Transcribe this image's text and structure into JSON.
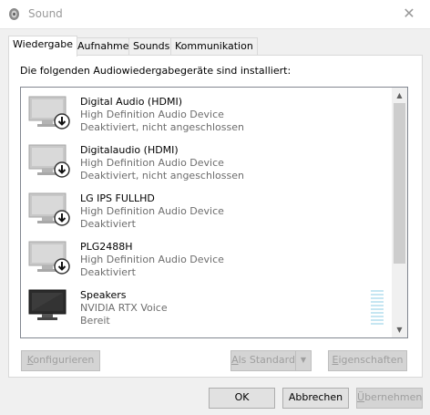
{
  "window": {
    "title": "Sound",
    "close_glyph": "✕"
  },
  "tabs": [
    {
      "label": "Wiedergabe"
    },
    {
      "label": "Aufnahme"
    },
    {
      "label": "Sounds"
    },
    {
      "label": "Kommunikation"
    }
  ],
  "instruction": "Die folgenden Audiowiedergabegeräte sind installiert:",
  "devices": [
    {
      "name": "Digital Audio (HDMI)",
      "driver": "High Definition Audio Device",
      "status": "Deaktiviert, nicht angeschlossen",
      "icon": "monitor-disabled-icon"
    },
    {
      "name": "Digitalaudio (HDMI)",
      "driver": "High Definition Audio Device",
      "status": "Deaktiviert, nicht angeschlossen",
      "icon": "monitor-disabled-icon"
    },
    {
      "name": "LG IPS FULLHD",
      "driver": "High Definition Audio Device",
      "status": "Deaktiviert",
      "icon": "monitor-disabled-icon"
    },
    {
      "name": "PLG2488H",
      "driver": "High Definition Audio Device",
      "status": "Deaktiviert",
      "icon": "monitor-disabled-icon"
    },
    {
      "name": "Speakers",
      "driver": "NVIDIA RTX Voice",
      "status": "Bereit",
      "icon": "monitor-speaker-icon"
    }
  ],
  "buttons": {
    "configure_pre": "",
    "configure_ul": "K",
    "configure_post": "onfigurieren",
    "default_pre": "",
    "default_ul": "A",
    "default_post": "ls Standard",
    "properties_pre": "",
    "properties_ul": "E",
    "properties_post": "igenschaften",
    "ok": "OK",
    "cancel": "Abbrechen",
    "apply_pre": "",
    "apply_ul": "Ü",
    "apply_post": "bernehmen"
  },
  "colors": {
    "accent": "#0078d7",
    "disabled_text": "#9f9f9f"
  }
}
